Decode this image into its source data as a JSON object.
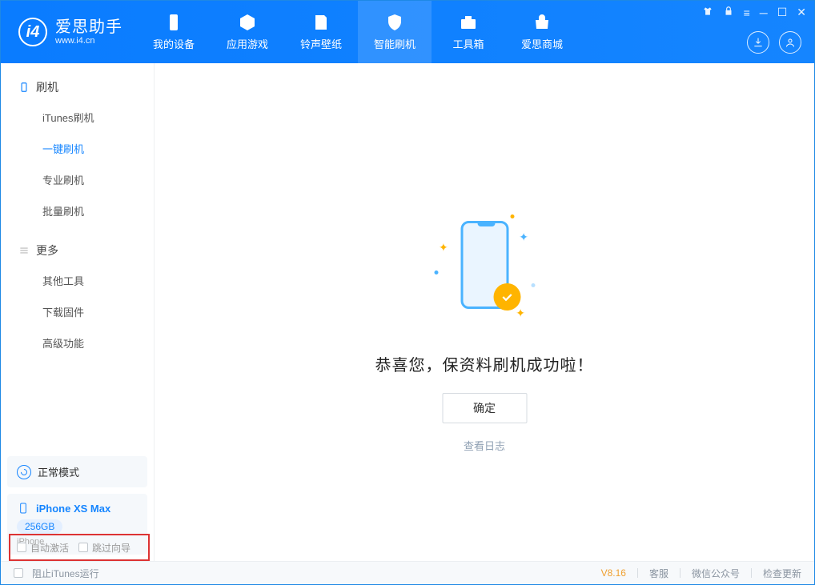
{
  "brand": {
    "title": "爱思助手",
    "subtitle": "www.i4.cn"
  },
  "tabs": {
    "my_device": "我的设备",
    "apps_games": "应用游戏",
    "ringtones": "铃声壁纸",
    "smart_flash": "智能刷机",
    "toolbox": "工具箱",
    "store": "爱思商城"
  },
  "sidebar": {
    "section1_title": "刷机",
    "items1": [
      "iTunes刷机",
      "一键刷机",
      "专业刷机",
      "批量刷机"
    ],
    "section2_title": "更多",
    "items2": [
      "其他工具",
      "下载固件",
      "高级功能"
    ]
  },
  "mode": {
    "label": "正常模式"
  },
  "device": {
    "name": "iPhone XS Max",
    "storage": "256GB",
    "type": "iPhone"
  },
  "result": {
    "title": "恭喜您，保资料刷机成功啦！",
    "ok": "确定",
    "view_log": "查看日志"
  },
  "checks": {
    "auto_activate": "自动激活",
    "skip_guide": "跳过向导"
  },
  "footer": {
    "block_itunes": "阻止iTunes运行",
    "version": "V8.16",
    "support": "客服",
    "wechat": "微信公众号",
    "update": "检查更新"
  }
}
